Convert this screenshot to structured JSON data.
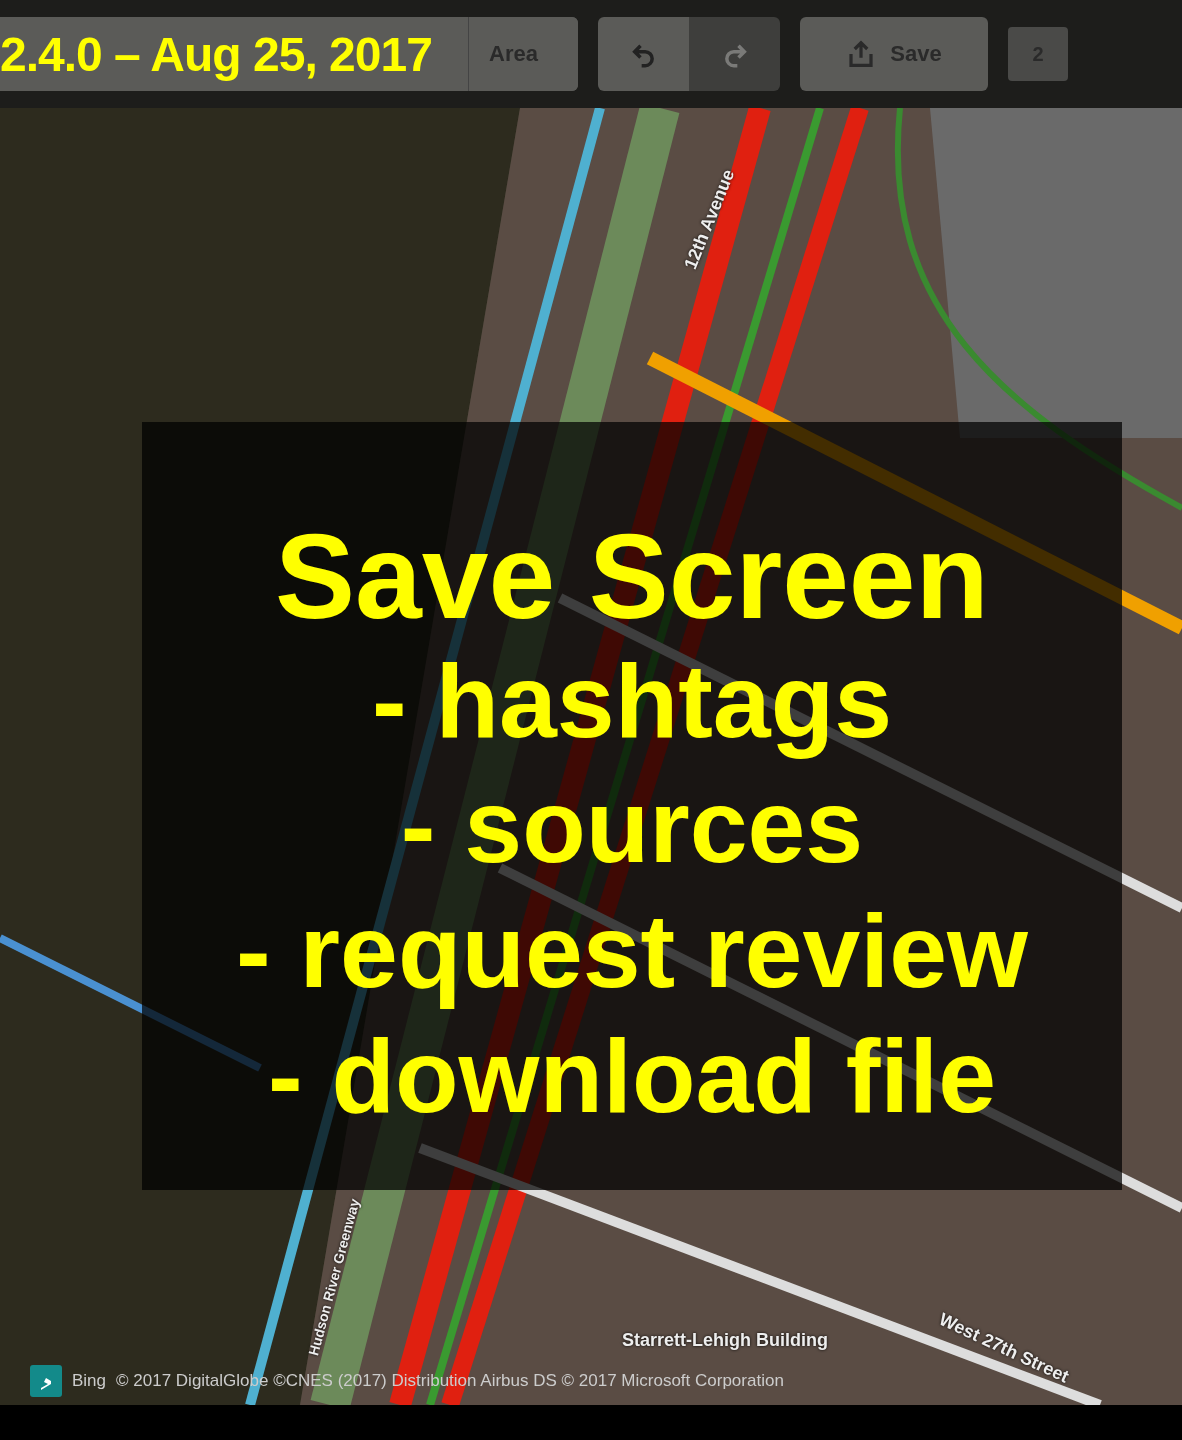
{
  "toolbar": {
    "modes": [
      {
        "label": "Area",
        "disabled": false
      }
    ],
    "undo_disabled": false,
    "redo_disabled": true,
    "save": {
      "label": "Save",
      "disabled": false
    },
    "edit_count": "2"
  },
  "version_banner": "2.4.0 – Aug 25, 2017",
  "slide": {
    "title": "Save Screen",
    "items": [
      "- hashtags",
      "- sources",
      "- request review",
      "- download file"
    ]
  },
  "map": {
    "labels": [
      "12th Avenue",
      "West 27th Street",
      "Hudson River Greenway",
      "Starrett-Lehigh Building"
    ]
  },
  "attribution": {
    "provider": "Bing",
    "text": "© 2017 DigitalGlobe ©CNES (2017) Distribution Airbus DS © 2017 Microsoft Corporation"
  }
}
